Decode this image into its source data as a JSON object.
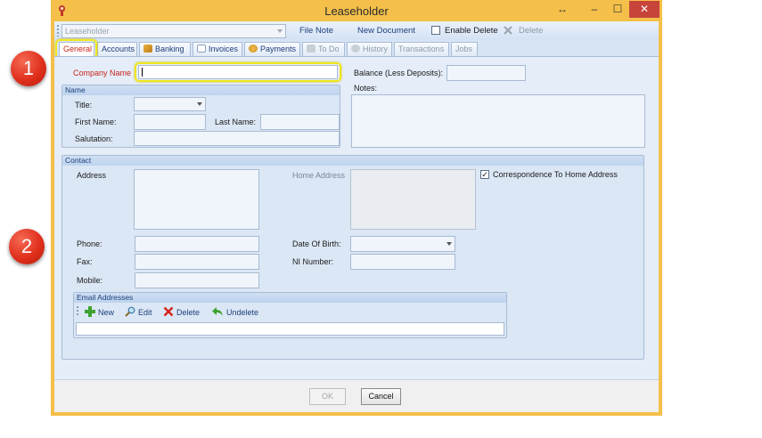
{
  "window": {
    "title": "Leaseholder"
  },
  "toolbar": {
    "record_combo": "Leaseholder",
    "file_note": "File Note",
    "new_document": "New Document",
    "enable_delete": "Enable Delete",
    "delete": "Delete"
  },
  "tabs": [
    {
      "label": "General",
      "state": "active"
    },
    {
      "label": "Accounts",
      "state": "enabled"
    },
    {
      "label": "Banking",
      "state": "enabled"
    },
    {
      "label": "Invoices",
      "state": "enabled"
    },
    {
      "label": "Payments",
      "state": "enabled"
    },
    {
      "label": "To Do",
      "state": "disabled"
    },
    {
      "label": "History",
      "state": "disabled"
    },
    {
      "label": "Transactions",
      "state": "disabled"
    },
    {
      "label": "Jobs",
      "state": "disabled"
    }
  ],
  "markers": {
    "one": "1",
    "two": "2"
  },
  "general": {
    "company_name_label": "Company Name",
    "company_name_value": "",
    "balance_label": "Balance (Less Deposits):",
    "notes_label": "Notes:",
    "name_group": {
      "title": "Name",
      "title_label": "Title:",
      "first_name_label": "First Name:",
      "last_name_label": "Last Name:",
      "salutation_label": "Salutation:"
    },
    "contact_group": {
      "title": "Contact",
      "address_label": "Address",
      "home_address_label": "Home Address",
      "correspondence_label": "Correspondence To Home Address",
      "correspondence_checked": true,
      "phone_label": "Phone:",
      "fax_label": "Fax:",
      "mobile_label": "Mobile:",
      "dob_label": "Date Of Birth:",
      "ni_label": "NI Number:",
      "email_group": {
        "title": "Email Addresses",
        "new": "New",
        "edit": "Edit",
        "delete": "Delete",
        "undelete": "Undelete"
      }
    }
  },
  "footer": {
    "ok": "OK",
    "cancel": "Cancel"
  },
  "colors": {
    "accent_red": "#c8231b",
    "frame": "#f4c04a",
    "highlight": "#f0e61f"
  }
}
